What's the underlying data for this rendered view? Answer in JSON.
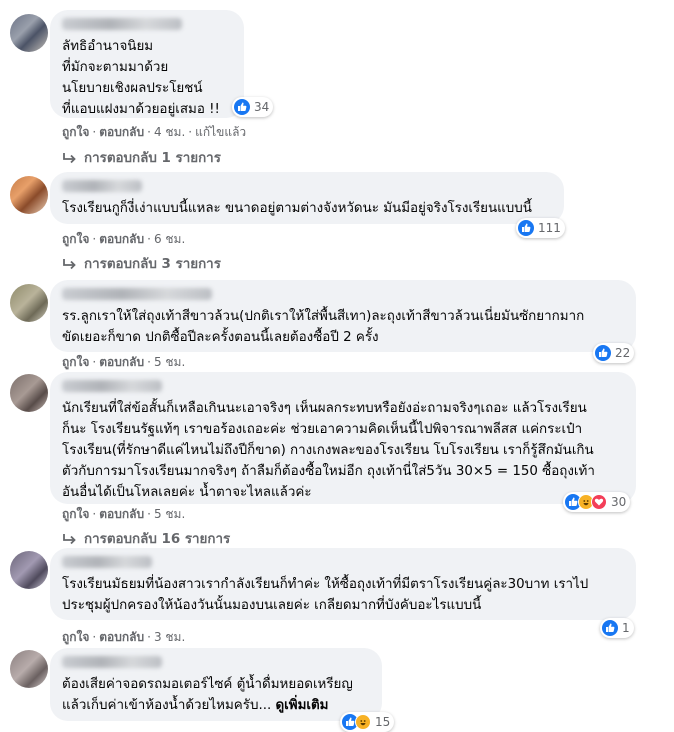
{
  "comments": [
    {
      "text": "ลัทธิอำนาจนิยม\nที่มักจะตามมาด้วย\nนโยบายเชิงผลประโยชน์\nที่แอบแฝงมาด้วยอยู่เสมอ !!",
      "reactions": "34",
      "like": "ถูกใจ",
      "reply": "ตอบกลับ",
      "time": "4 ชม.",
      "edited": "แก้ไขแล้ว",
      "replies": "การตอบกลับ 1 รายการ"
    },
    {
      "text": "โรงเรียนกูก็งี่เง่าแบบนี้แหละ ขนาดอยู่ตามต่างจังหวัดนะ มันมีอยู่จริงโรงเรียนแบบนี้",
      "reactions": "111",
      "like": "ถูกใจ",
      "reply": "ตอบกลับ",
      "time": "6 ชม.",
      "replies": "การตอบกลับ 3 รายการ"
    },
    {
      "text": "รร.ลูกเราให้ใส่ถุงเท้าสีขาวล้วน(ปกติเราให้ใส่พื้นสีเทา)ละถุงเท้าสีขาวล้วนเนี่ยมันซักยากมาก\nขัดเยอะก็ขาด ปกติซื้อปีละครั้งตอนนี้เลยต้องซื้อปี 2 ครั้ง",
      "reactions": "22",
      "like": "ถูกใจ",
      "reply": "ตอบกลับ",
      "time": "5 ชม."
    },
    {
      "text": "นักเรียนที่ใส่ข้อสั้นก็เหลือเกินนะเอาจริงๆ เห็นผลกระทบหรือยังอ่ะถามจริงๆเถอะ แล้วโรงเรียน\nก็นะ โรงเรียนรัฐแท้ๆ เราขอร้องเถอะค่ะ ช่วยเอาความคิดเห็นนี้ไปพิจารณาพลีสส แค่กระเป๋า\nโรงเรียน(ที่รักษาดีแค่ไหนไม่ถึงปีก็ขาด) กางเกงพละของโรงเรียน โบโรงเรียน เราก็รู้สึกมันเกิน\nตัวกับการมาโรงเรียนมากจริงๆ ถ้าลืมก็ต้องซื้อใหม่อีก ถุงเท้านี่ใส่5วัน 30×5 = 150 ซื้อถุงเท้า\nอันอื่นได้เป็นโหลเลยค่ะ น้ำตาจะไหลแล้วค่ะ",
      "reactions": "30",
      "like": "ถูกใจ",
      "reply": "ตอบกลับ",
      "time": "5 ชม.",
      "replies": "การตอบกลับ 16 รายการ"
    },
    {
      "text": "โรงเรียนมัธยมที่น้องสาวเรากำลังเรียนก็ทำค่ะ ให้ซื้อถุงเท้าที่มีตราโรงเรียนคู่ละ30บาท เราไป\nประชุมผู้ปกครองให้น้องวันนั้นมองบนเลยค่ะ เกลียดมากที่บังคับอะไรแบบนี้",
      "reactions": "1",
      "like": "ถูกใจ",
      "reply": "ตอบกลับ",
      "time": "3 ชม."
    },
    {
      "text": "ต้องเสียค่าจอดรถมอเตอร์ไซค์ ตู้น้ำดื่มหยอดเหรียญ\nแล้วเก็บค่าเข้าห้องน้ำด้วยไหมครับ... ",
      "see_more": "ดูเพิ่มเติม",
      "reactions": "15"
    }
  ],
  "icons": {
    "like": "like-reaction-icon",
    "haha": "haha-reaction-icon",
    "love": "love-reaction-icon",
    "reply_arrow": "reply-arrow-icon"
  },
  "colors": {
    "bubble": "#f0f2f5",
    "secondary_text": "#65676b",
    "like_blue": "#1877f2"
  }
}
